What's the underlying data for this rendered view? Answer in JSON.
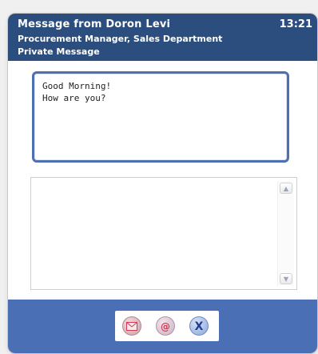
{
  "header": {
    "sender": "Message from Doron Levi",
    "time": "13:21",
    "role": "Procurement Manager, Sales Department",
    "message_type": "Private Message"
  },
  "message": {
    "lines": [
      "Good Morning!",
      "How are you?"
    ]
  },
  "reply": {
    "value": ""
  },
  "actions": {
    "email_glyph": "@",
    "close_glyph": "X",
    "icons": [
      "envelope-icon",
      "at-sign-icon",
      "close-x-icon"
    ]
  },
  "colors": {
    "header_bg": "#2c4e7e",
    "footer_bg": "#4a6fb5",
    "message_border": "#4e6fb0"
  }
}
